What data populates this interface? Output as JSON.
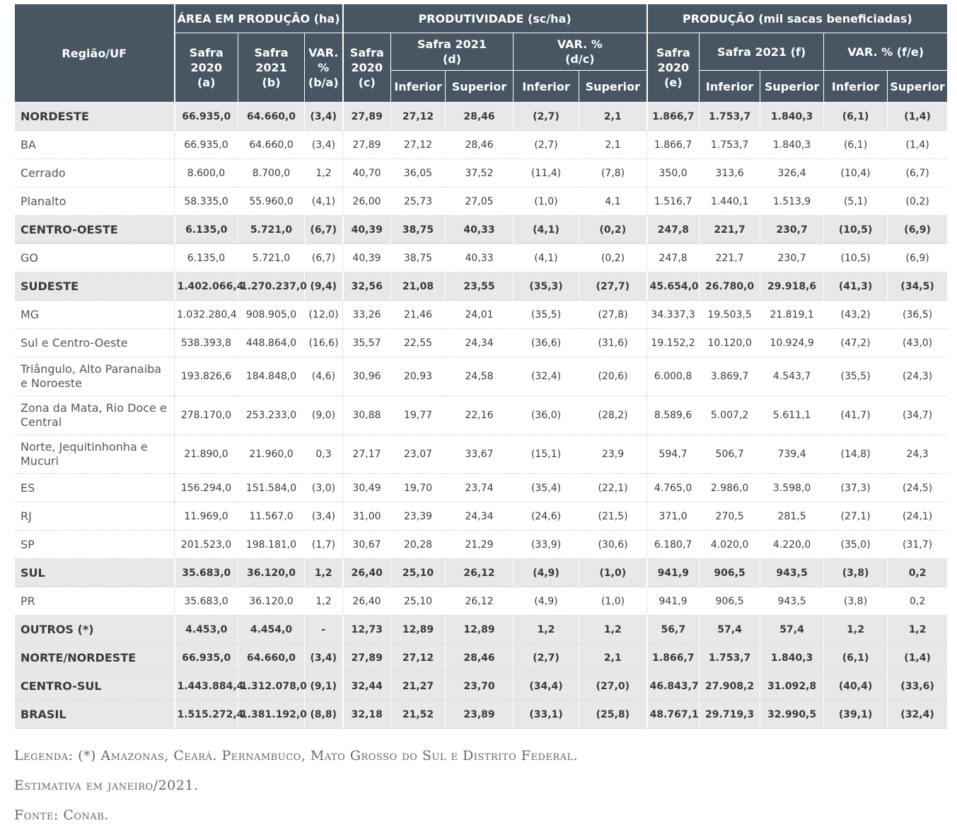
{
  "header": {
    "region": "Região/UF",
    "area": "ÁREA EM PRODUÇÃO (ha)",
    "prod": "PRODUTIVIDADE (sc/ha)",
    "producao": "PRODUÇÃO (mil sacas beneficiadas)",
    "a": [
      "Safra",
      "2020",
      "(a)"
    ],
    "b": [
      "Safra 2021",
      "(b)"
    ],
    "ba": [
      "VAR.",
      "%",
      "(b/a)"
    ],
    "c": [
      "Safra",
      "2020",
      "(c)"
    ],
    "d": [
      "Safra 2021",
      "(d)"
    ],
    "dc": [
      "VAR. %",
      "(d/c)"
    ],
    "e": [
      "Safra",
      "2020",
      "(e)"
    ],
    "f": "Safra 2021 (f)",
    "fe": "VAR. % (f/e)",
    "inferior": "Inferior",
    "superior": "Superior"
  },
  "rows": [
    {
      "type": "bold",
      "cells": [
        "NORDESTE",
        "66.935,0",
        "64.660,0",
        "(3,4)",
        "27,89",
        "27,12",
        "28,46",
        "(2,7)",
        "2,1",
        "1.866,7",
        "1.753,7",
        "1.840,3",
        "(6,1)",
        "(1,4)"
      ]
    },
    {
      "type": "normal",
      "cells": [
        "BA",
        "66.935,0",
        "64.660,0",
        "(3,4)",
        "27,89",
        "27,12",
        "28,46",
        "(2,7)",
        "2,1",
        "1.866,7",
        "1.753,7",
        "1.840,3",
        "(6,1)",
        "(1,4)"
      ]
    },
    {
      "type": "normal",
      "cells": [
        "Cerrado",
        "8.600,0",
        "8.700,0",
        "1,2",
        "40,70",
        "36,05",
        "37,52",
        "(11,4)",
        "(7,8)",
        "350,0",
        "313,6",
        "326,4",
        "(10,4)",
        "(6,7)"
      ]
    },
    {
      "type": "normal",
      "cells": [
        "Planalto",
        "58.335,0",
        "55.960,0",
        "(4,1)",
        "26,00",
        "25,73",
        "27,05",
        "(1,0)",
        "4,1",
        "1.516,7",
        "1.440,1",
        "1.513,9",
        "(5,1)",
        "(0,2)"
      ]
    },
    {
      "type": "bold",
      "cells": [
        "CENTRO-OESTE",
        "6.135,0",
        "5.721,0",
        "(6,7)",
        "40,39",
        "38,75",
        "40,33",
        "(4,1)",
        "(0,2)",
        "247,8",
        "221,7",
        "230,7",
        "(10,5)",
        "(6,9)"
      ]
    },
    {
      "type": "normal",
      "cells": [
        "GO",
        "6.135,0",
        "5.721,0",
        "(6,7)",
        "40,39",
        "38,75",
        "40,33",
        "(4,1)",
        "(0,2)",
        "247,8",
        "221,7",
        "230,7",
        "(10,5)",
        "(6,9)"
      ]
    },
    {
      "type": "bold",
      "cells": [
        "SUDESTE",
        "1.402.066,4",
        "1.270.237,0",
        "(9,4)",
        "32,56",
        "21,08",
        "23,55",
        "(35,3)",
        "(27,7)",
        "45.654,0",
        "26.780,0",
        "29.918,6",
        "(41,3)",
        "(34,5)"
      ]
    },
    {
      "type": "normal",
      "cells": [
        "MG",
        "1.032.280,4",
        "908.905,0",
        "(12,0)",
        "33,26",
        "21,46",
        "24,01",
        "(35,5)",
        "(27,8)",
        "34.337,3",
        "19.503,5",
        "21.819,1",
        "(43,2)",
        "(36,5)"
      ]
    },
    {
      "type": "normal",
      "cells": [
        "Sul e Centro-Oeste",
        "538.393,8",
        "448.864,0",
        "(16,6)",
        "35,57",
        "22,55",
        "24,34",
        "(36,6)",
        "(31,6)",
        "19.152,2",
        "10.120,0",
        "10.924,9",
        "(47,2)",
        "(43,0)"
      ]
    },
    {
      "type": "tall",
      "cells": [
        "Triângulo, Alto Paranaiba e Noroeste",
        "193.826,6",
        "184.848,0",
        "(4,6)",
        "30,96",
        "20,93",
        "24,58",
        "(32,4)",
        "(20,6)",
        "6.000,8",
        "3.869,7",
        "4.543,7",
        "(35,5)",
        "(24,3)"
      ]
    },
    {
      "type": "tall",
      "cells": [
        "Zona da Mata, Rio Doce e Central",
        "278.170,0",
        "253.233,0",
        "(9,0)",
        "30,88",
        "19,77",
        "22,16",
        "(36,0)",
        "(28,2)",
        "8.589,6",
        "5.007,2",
        "5.611,1",
        "(41,7)",
        "(34,7)"
      ]
    },
    {
      "type": "tall",
      "cells": [
        "Norte, Jequitinhonha e Mucuri",
        "21.890,0",
        "21.960,0",
        "0,3",
        "27,17",
        "23,07",
        "33,67",
        "(15,1)",
        "23,9",
        "594,7",
        "506,7",
        "739,4",
        "(14,8)",
        "24,3"
      ]
    },
    {
      "type": "normal",
      "cells": [
        "ES",
        "156.294,0",
        "151.584,0",
        "(3,0)",
        "30,49",
        "19,70",
        "23,74",
        "(35,4)",
        "(22,1)",
        "4.765,0",
        "2.986,0",
        "3.598,0",
        "(37,3)",
        "(24,5)"
      ]
    },
    {
      "type": "normal",
      "cells": [
        "RJ",
        "11.969,0",
        "11.567,0",
        "(3,4)",
        "31,00",
        "23,39",
        "24,34",
        "(24,6)",
        "(21,5)",
        "371,0",
        "270,5",
        "281,5",
        "(27,1)",
        "(24,1)"
      ]
    },
    {
      "type": "normal",
      "cells": [
        "SP",
        "201.523,0",
        "198.181,0",
        "(1,7)",
        "30,67",
        "20,28",
        "21,29",
        "(33,9)",
        "(30,6)",
        "6.180,7",
        "4.020,0",
        "4.220,0",
        "(35,0)",
        "(31,7)"
      ]
    },
    {
      "type": "bold",
      "cells": [
        "SUL",
        "35.683,0",
        "36.120,0",
        "1,2",
        "26,40",
        "25,10",
        "26,12",
        "(4,9)",
        "(1,0)",
        "941,9",
        "906,5",
        "943,5",
        "(3,8)",
        "0,2"
      ]
    },
    {
      "type": "normal",
      "cells": [
        "PR",
        "35.683,0",
        "36.120,0",
        "1,2",
        "26,40",
        "25,10",
        "26,12",
        "(4,9)",
        "(1,0)",
        "941,9",
        "906,5",
        "943,5",
        "(3,8)",
        "0,2"
      ]
    },
    {
      "type": "bold",
      "cells": [
        "OUTROS (*)",
        "4.453,0",
        "4.454,0",
        "-",
        "12,73",
        "12,89",
        "12,89",
        "1,2",
        "1,2",
        "56,7",
        "57,4",
        "57,4",
        "1,2",
        "1,2"
      ]
    },
    {
      "type": "bold",
      "cells": [
        "NORTE/NORDESTE",
        "66.935,0",
        "64.660,0",
        "(3,4)",
        "27,89",
        "27,12",
        "28,46",
        "(2,7)",
        "2,1",
        "1.866,7",
        "1.753,7",
        "1.840,3",
        "(6,1)",
        "(1,4)"
      ]
    },
    {
      "type": "bold",
      "cells": [
        "CENTRO-SUL",
        "1.443.884,4",
        "1.312.078,0",
        "(9,1)",
        "32,44",
        "21,27",
        "23,70",
        "(34,4)",
        "(27,0)",
        "46.843,7",
        "27.908,2",
        "31.092,8",
        "(40,4)",
        "(33,6)"
      ]
    },
    {
      "type": "bold",
      "cells": [
        "BRASIL",
        "1.515.272,4",
        "1.381.192,0",
        "(8,8)",
        "32,18",
        "21,52",
        "23,89",
        "(33,1)",
        "(25,8)",
        "48.767,1",
        "29.719,3",
        "32.990,5",
        "(39,1)",
        "(32,4)"
      ]
    }
  ],
  "footnotes": [
    "Legenda: (*) Amazonas, Ceará. Pernambuco, Mato Grosso do Sul e Distrito Federal.",
    "Estimativa em janeiro/2021.",
    "Fonte: Conab."
  ]
}
